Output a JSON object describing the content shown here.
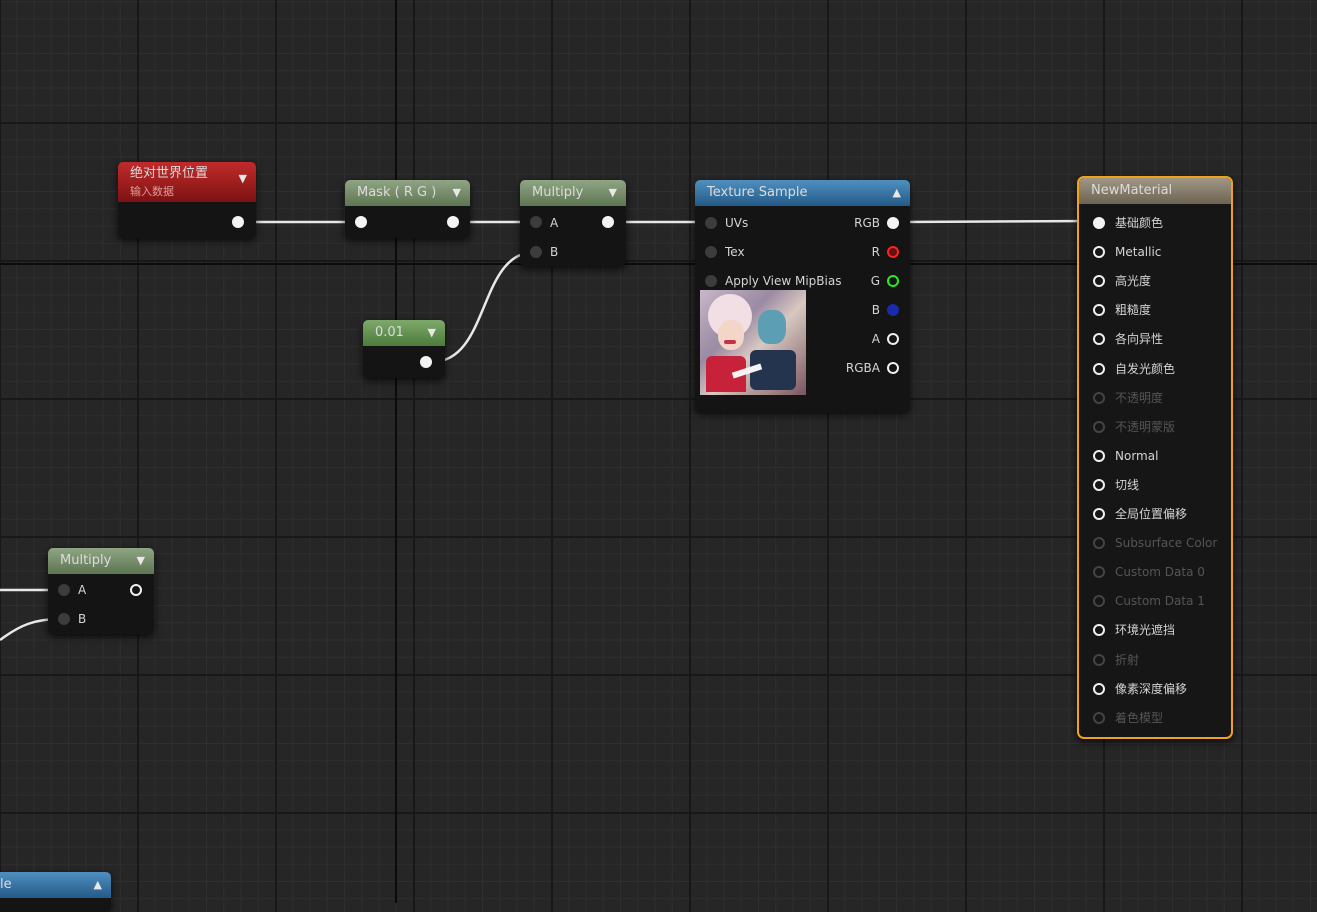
{
  "nodes": {
    "world_position": {
      "title": "绝对世界位置",
      "subtitle": "输入数据"
    },
    "mask": {
      "title": "Mask ( R G )"
    },
    "multiply_top": {
      "title": "Multiply",
      "pin_a": "A",
      "pin_b": "B"
    },
    "constant": {
      "title": "0.01"
    },
    "texture_sample": {
      "title": "Texture Sample",
      "inputs": [
        "UVs",
        "Tex",
        "Apply View MipBias"
      ],
      "outputs": [
        "RGB",
        "R",
        "G",
        "B",
        "A",
        "RGBA"
      ]
    },
    "multiply_bottom": {
      "title": "Multiply",
      "pin_a": "A",
      "pin_b": "B"
    },
    "partial_node": {
      "title": "le"
    },
    "material": {
      "title": "NewMaterial",
      "pins": [
        {
          "label": "基础颜色",
          "enabled": true
        },
        {
          "label": "Metallic",
          "enabled": true
        },
        {
          "label": "高光度",
          "enabled": true
        },
        {
          "label": "粗糙度",
          "enabled": true
        },
        {
          "label": "各向异性",
          "enabled": true
        },
        {
          "label": "自发光颜色",
          "enabled": true
        },
        {
          "label": "不透明度",
          "enabled": false
        },
        {
          "label": "不透明蒙版",
          "enabled": false
        },
        {
          "label": "Normal",
          "enabled": true
        },
        {
          "label": "切线",
          "enabled": true
        },
        {
          "label": "全局位置偏移",
          "enabled": true
        },
        {
          "label": "Subsurface Color",
          "enabled": false
        },
        {
          "label": "Custom Data 0",
          "enabled": false
        },
        {
          "label": "Custom Data 1",
          "enabled": false
        },
        {
          "label": "环境光遮挡",
          "enabled": true
        },
        {
          "label": "折射",
          "enabled": false
        },
        {
          "label": "像素深度偏移",
          "enabled": true
        },
        {
          "label": "着色模型",
          "enabled": false
        }
      ]
    }
  },
  "colors": {
    "material_border": "#f0a21c",
    "wire": "#e8e8e8",
    "r_pin": "#ff2222",
    "g_pin": "#22ee22",
    "b_pin": "#1a2aaa"
  }
}
